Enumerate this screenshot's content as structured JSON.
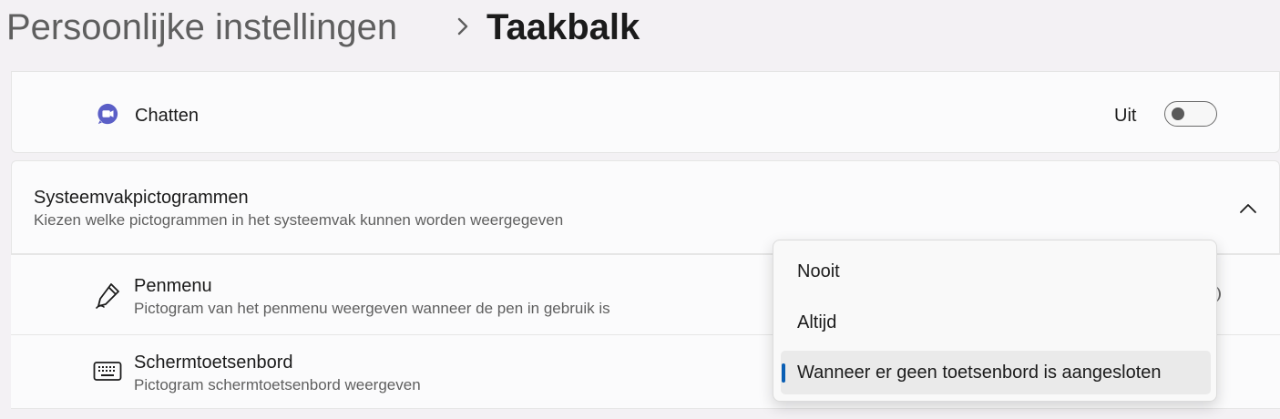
{
  "breadcrumb": {
    "parent": "Persoonlijke instellingen",
    "current": "Taakbalk"
  },
  "chat": {
    "label": "Chatten",
    "toggle_state": "Uit"
  },
  "tray_section": {
    "title": "Systeemvakpictogrammen",
    "description": "Kiezen welke pictogrammen in het systeemvak kunnen worden weergegeven"
  },
  "pen_menu": {
    "label": "Penmenu",
    "description": "Pictogram van het penmenu weergeven wanneer de pen in gebruik is"
  },
  "touch_keyboard": {
    "label": "Schermtoetsenbord",
    "description": "Pictogram schermtoetsenbord weergeven"
  },
  "dropdown": {
    "options": [
      "Nooit",
      "Altijd",
      "Wanneer er geen toetsenbord is aangesloten"
    ],
    "selected_index": 2
  },
  "colors": {
    "accent": "#0a5fb4",
    "chat_icon": "#5b5fc7"
  }
}
